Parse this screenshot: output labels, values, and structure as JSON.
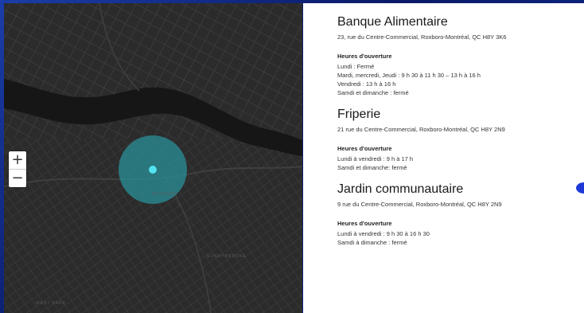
{
  "map": {
    "zoom_in_label": "+",
    "zoom_out_label": "−",
    "labels": {
      "district": "ROXBORO",
      "sunnybrooke": "SUNNYBROOKE",
      "west_park": "WEST PARK"
    }
  },
  "places": [
    {
      "name": "Banque Alimentaire",
      "address": "23, rue du Centre-Commercial, Roxboro-Montréal, QC H8Y 3K6",
      "hours_title": "Heures d'ouverture",
      "hours": [
        "Lundi : Fermé",
        "Mardi, mercredi, Jeudi : 9 h 30 à 11 h 30 – 13 h à 16 h",
        "Vendredi : 13 h à 16 h",
        "Samdi et dimanche : fermé"
      ]
    },
    {
      "name": "Friperie",
      "address": "21 rue du Centre-Commercial, Roxboro-Montréal, QC H8Y 2N9",
      "hours_title": "Heures d'ouverture",
      "hours": [
        "Lundi à vendredi : 9 h à 17 h",
        "Samdi et dimanche: fermé"
      ]
    },
    {
      "name": "Jardin communautaire",
      "address": "9 rue du Centre-Commercial, Roxboro-Montréal, QC H8Y 2N9",
      "hours_title": "Heures d'ouverture",
      "hours": [
        "Lundi à vendredi : 9 h 30 à 16 h 30",
        "Samdi à dimanche : fermé"
      ]
    }
  ],
  "colors": {
    "map_bg": "#2b2b2b",
    "river": "#161616",
    "marker": "#3ec9d6",
    "marker_halo": "#2a8c95",
    "frame": "#1230a0"
  }
}
